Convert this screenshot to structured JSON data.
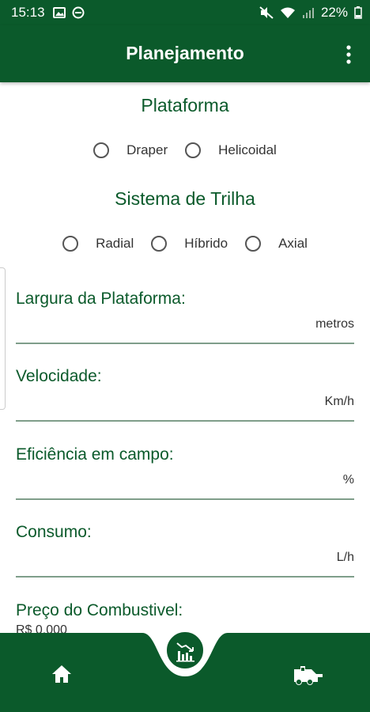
{
  "status_bar": {
    "time": "15:13",
    "battery": "22%"
  },
  "appbar": {
    "title": "Planejamento",
    "menu_icon": "more-vert-icon"
  },
  "plataforma": {
    "title": "Plataforma",
    "options": [
      "Draper",
      "Helicoidal"
    ]
  },
  "sistema_trilha": {
    "title": "Sistema de Trilha",
    "options": [
      "Radial",
      "Híbrido",
      "Axial"
    ]
  },
  "fields": [
    {
      "label": "Largura da Plataforma:",
      "unit": "metros"
    },
    {
      "label": "Velocidade:",
      "unit": "Km/h"
    },
    {
      "label": "Eficiência em campo:",
      "unit": "%"
    },
    {
      "label": "Consumo:",
      "unit": "L/h"
    },
    {
      "label": "Preço do Combustivel:",
      "value": "R$ 0,000"
    }
  ],
  "bottom_nav": {
    "home_icon": "home-icon",
    "center_icon": "chart-icon",
    "right_icon": "harvester-icon"
  },
  "colors": {
    "primary": "#0b5a2b",
    "line": "#7f9e8a"
  }
}
